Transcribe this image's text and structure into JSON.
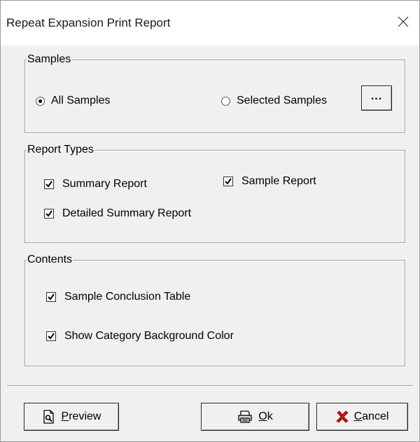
{
  "window": {
    "title": "Repeat Expansion Print Report"
  },
  "samples": {
    "legend": "Samples",
    "all_samples_label": "All Samples",
    "all_samples_selected": true,
    "selected_samples_label": "Selected Samples",
    "selected_samples_selected": false,
    "browse_button_label": "..."
  },
  "report_types": {
    "legend": "Report Types",
    "summary_report_label": "Summary Report",
    "summary_report_checked": true,
    "sample_report_label": "Sample Report",
    "sample_report_checked": true,
    "detailed_summary_report_label": "Detailed Summary Report",
    "detailed_summary_report_checked": true
  },
  "contents": {
    "legend": "Contents",
    "sample_conclusion_table_label": "Sample Conclusion Table",
    "sample_conclusion_table_checked": true,
    "show_category_background_color_label": "Show Category Background Color",
    "show_category_background_color_checked": true
  },
  "buttons": {
    "preview": {
      "mnemonic": "P",
      "rest": "review",
      "icon": "preview-icon"
    },
    "ok": {
      "mnemonic": "O",
      "rest": "k",
      "icon": "printer-icon"
    },
    "cancel": {
      "mnemonic": "C",
      "rest": "ancel",
      "icon": "cancel-x-icon"
    }
  },
  "colors": {
    "cancel_icon": "#cc1111",
    "frame_border": "#a0a0a0",
    "dialog_bg": "#f0f0f0"
  }
}
